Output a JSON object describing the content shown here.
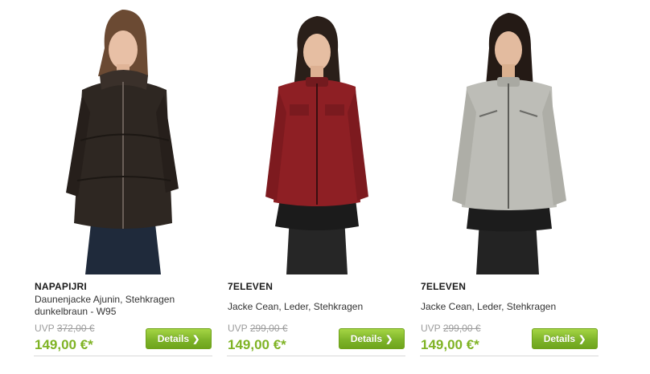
{
  "products": [
    {
      "brand": "NAPAPIJRI",
      "title": "Daunenjacke Ajunin, Stehkragen dunkelbraun - W95",
      "uvp_label": "UVP",
      "uvp_price": "372,00 €",
      "price": "149,00 €*",
      "details_label": "Details",
      "details_icon": "chevron-right-icon",
      "jacket_color": "#2e2722"
    },
    {
      "brand": "7ELEVEN",
      "title": "Jacke Cean, Leder, Stehkragen",
      "uvp_label": "UVP",
      "uvp_price": "299,00 €",
      "price": "149,00 €*",
      "details_label": "Details",
      "details_icon": "chevron-right-icon",
      "jacket_color": "#8e1f24"
    },
    {
      "brand": "7ELEVEN",
      "title": "Jacke Cean, Leder, Stehkragen",
      "uvp_label": "UVP",
      "uvp_price": "299,00 €",
      "price": "149,00 €*",
      "details_label": "Details",
      "details_icon": "chevron-right-icon",
      "jacket_color": "#bdbdb7"
    }
  ],
  "colors": {
    "price": "#7fb324",
    "button": "#7fb52a",
    "uvp": "#9b9b9b"
  }
}
